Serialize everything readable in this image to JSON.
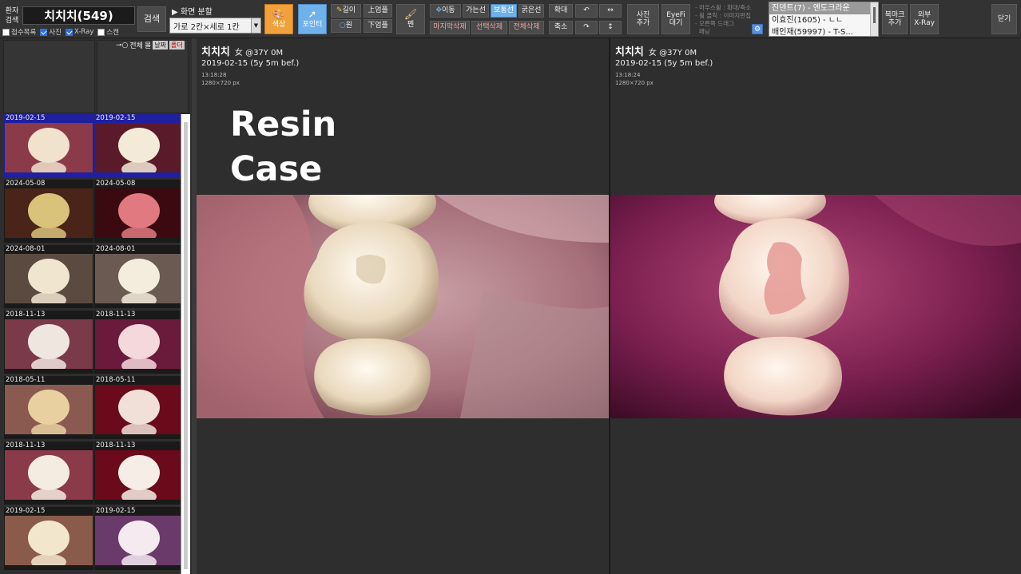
{
  "toolbar": {
    "patient_search_label": "환자\n검색",
    "patient_name": "치치치(549)",
    "search_button": "검색",
    "filters": [
      {
        "label": "접수목록",
        "checked": false
      },
      {
        "label": "사진",
        "checked": true
      },
      {
        "label": "X-Ray",
        "checked": true
      },
      {
        "label": "스캔",
        "checked": false
      }
    ],
    "split_label": "▶ 화면 분할",
    "split_value": "가로 2칸×세로 1칸",
    "color_button": "색상",
    "pointer_button": "포인터",
    "length_button": "길이",
    "circle_button": "원",
    "upper_button": "上엄플",
    "lower_button": "下엄플",
    "pen_button": "펜",
    "move_button": "이동",
    "thin_line_button": "가는선",
    "normal_line_button": "보통선",
    "thick_line_button": "굵은선",
    "delete_last_button": "마지막삭제",
    "delete_selected_button": "선택삭제",
    "delete_all_button": "전체삭제",
    "zoom_in_button": "확대",
    "zoom_out_button": "축소",
    "add_photo_button": "사진\n추가",
    "eyefi_button": "EyeFi\n대기",
    "hint_lines": [
      "- 마우스휠 : 확대/축소",
      "- 휠 클릭 : 이미지편집",
      "- 오른쪽 드래그",
      "  패닝"
    ],
    "list_items": [
      "진덴트(7) - 엔도크라운",
      "이효진(1605) - ㄴㄴ",
      "배인재(59997) - T-S..."
    ],
    "bookmark_button": "북마크\n추가",
    "external_xray_button": "외부\nX-Ray",
    "close_button": "닫기"
  },
  "sidebar": {
    "all_label": "전체",
    "sort_label": "몰",
    "date_tag": "날짜",
    "group_tag": "폴더",
    "thumbnails": [
      {
        "date": "2019-02-15",
        "selected": true
      },
      {
        "date": "2019-02-15",
        "selected": true
      },
      {
        "date": "2024-05-08",
        "selected": false
      },
      {
        "date": "2024-05-08",
        "selected": false
      },
      {
        "date": "2024-08-01",
        "selected": false
      },
      {
        "date": "2024-08-01",
        "selected": false
      },
      {
        "date": "2018-11-13",
        "selected": false
      },
      {
        "date": "2018-11-13",
        "selected": false
      },
      {
        "date": "2018-05-11",
        "selected": false
      },
      {
        "date": "2018-05-11",
        "selected": false
      },
      {
        "date": "2018-11-13",
        "selected": false
      },
      {
        "date": "2018-11-13",
        "selected": false
      },
      {
        "date": "2019-02-15",
        "selected": false
      },
      {
        "date": "2019-02-15",
        "selected": false
      }
    ]
  },
  "viewer": {
    "overlay_text_1": "Resin",
    "overlay_text_2": "Case",
    "panes": [
      {
        "name": "치치치",
        "gender_age": "女 @37Y 0M",
        "date": "2019-02-15 (5y 5m bef.)",
        "time": "13:18:28",
        "size": "1280×720 px"
      },
      {
        "name": "치치치",
        "gender_age": "女 @37Y 0M",
        "date": "2019-02-15 (5y 5m bef.)",
        "time": "13:18:24",
        "size": "1280×720 px"
      }
    ]
  },
  "colors": {
    "toolbar_bg": "#333333",
    "color_button": "#f0a13a",
    "pointer_button": "#6fb1ea",
    "selected_thumb": "#1f1fa0"
  }
}
